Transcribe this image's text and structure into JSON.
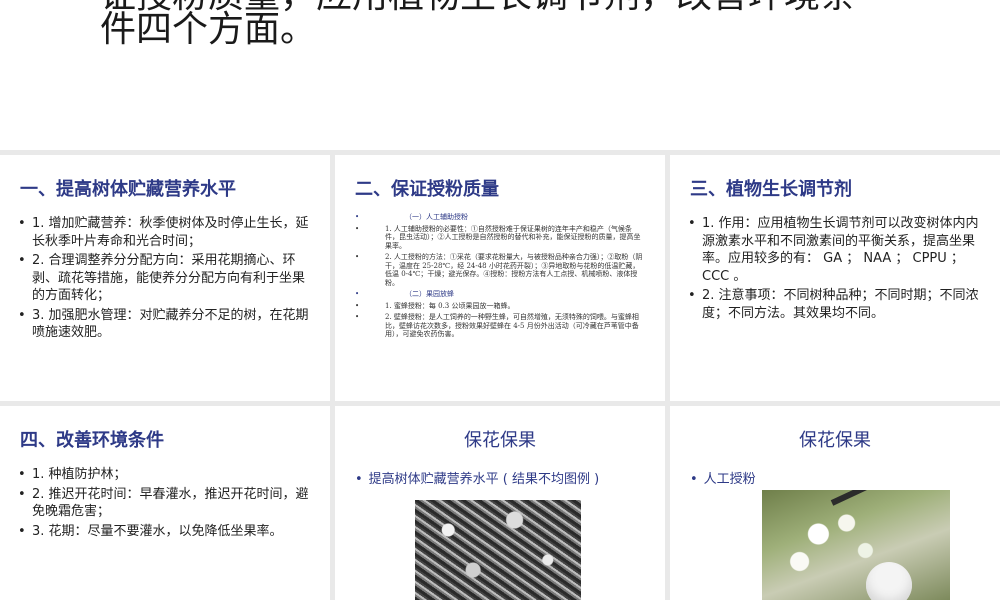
{
  "header": {
    "line1": "证授粉质量，应用植物生长调节剂，改善环境条",
    "line2": "件四个方面。"
  },
  "slides": [
    {
      "title": "一、提高树体贮藏营养水平",
      "bullets": [
        "1. 增加贮藏营养：秋季使树体及时停止生长，延长秋季叶片寿命和光合时间；",
        "2. 合理调整养分分配方向：采用花期摘心、环剥、疏花等措施，能使养分分配方向有利于坐果的方面转化；",
        "3. 加强肥水管理：对贮藏养分不足的树，在花期喷施速效肥。"
      ]
    },
    {
      "title": "二、保证授粉质量",
      "items": [
        "（一）人工辅助授粉",
        "1. 人工辅助授粉的必要性：①自然授粉难于保证果树的连年丰产和稳产（气候条件，昆虫活动）；②人工授粉是自然授粉的替代和补充，能保证授粉的质量，提高坐果率。",
        "2. 人工授粉的方法：①采花（要求花粉量大，与被授粉品种亲合力强）；②取粉（阴干，温度在 25-28℃，经 24-48 小时花药开裂）；③异地取粉与花粉的低温贮藏，低温 0-4℃；干燥；避光保存。④授粉：授粉方法有人工点授、机械喷粉、液体授粉。",
        "（二）果园放蜂",
        "1. 蜜蜂授粉：每 0.3 公顷果园放一箱蜂。",
        "2. 壁蜂授粉：是人工饲养的一种野生蜂，可自然增殖，无须特殊的饲喂。与蜜蜂相比，壁蜂访花次数多，授粉效果好壁蜂在 4-5 月份外出活动（可冷藏在芦苇管中备用），可避免农药伤害。"
      ]
    },
    {
      "title": "三、植物生长调节剂",
      "bullets": [
        "1. 作用：应用植物生长调节剂可以改变树体内内源激素水平和不同激素间的平衡关系，提高坐果率。应用较多的有： GA ； NAA ； CPPU ； CCC 。",
        "2. 注意事项：不同树种品种；不同时期；不同浓度；不同方法。其效果均不同。"
      ]
    },
    {
      "title": "四、改善环境条件",
      "bullets": [
        "1. 种植防护林；",
        "2. 推迟开花时间：早春灌水，推迟开花时间，避免晚霜危害；",
        "3. 花期：尽量不要灌水，以免降低坐果率。"
      ]
    },
    {
      "title": "保花保果",
      "sub": "提高树体贮藏营养水平 ( 结果不均图例 )"
    },
    {
      "title": "保花保果",
      "sub": "人工授粉"
    }
  ]
}
